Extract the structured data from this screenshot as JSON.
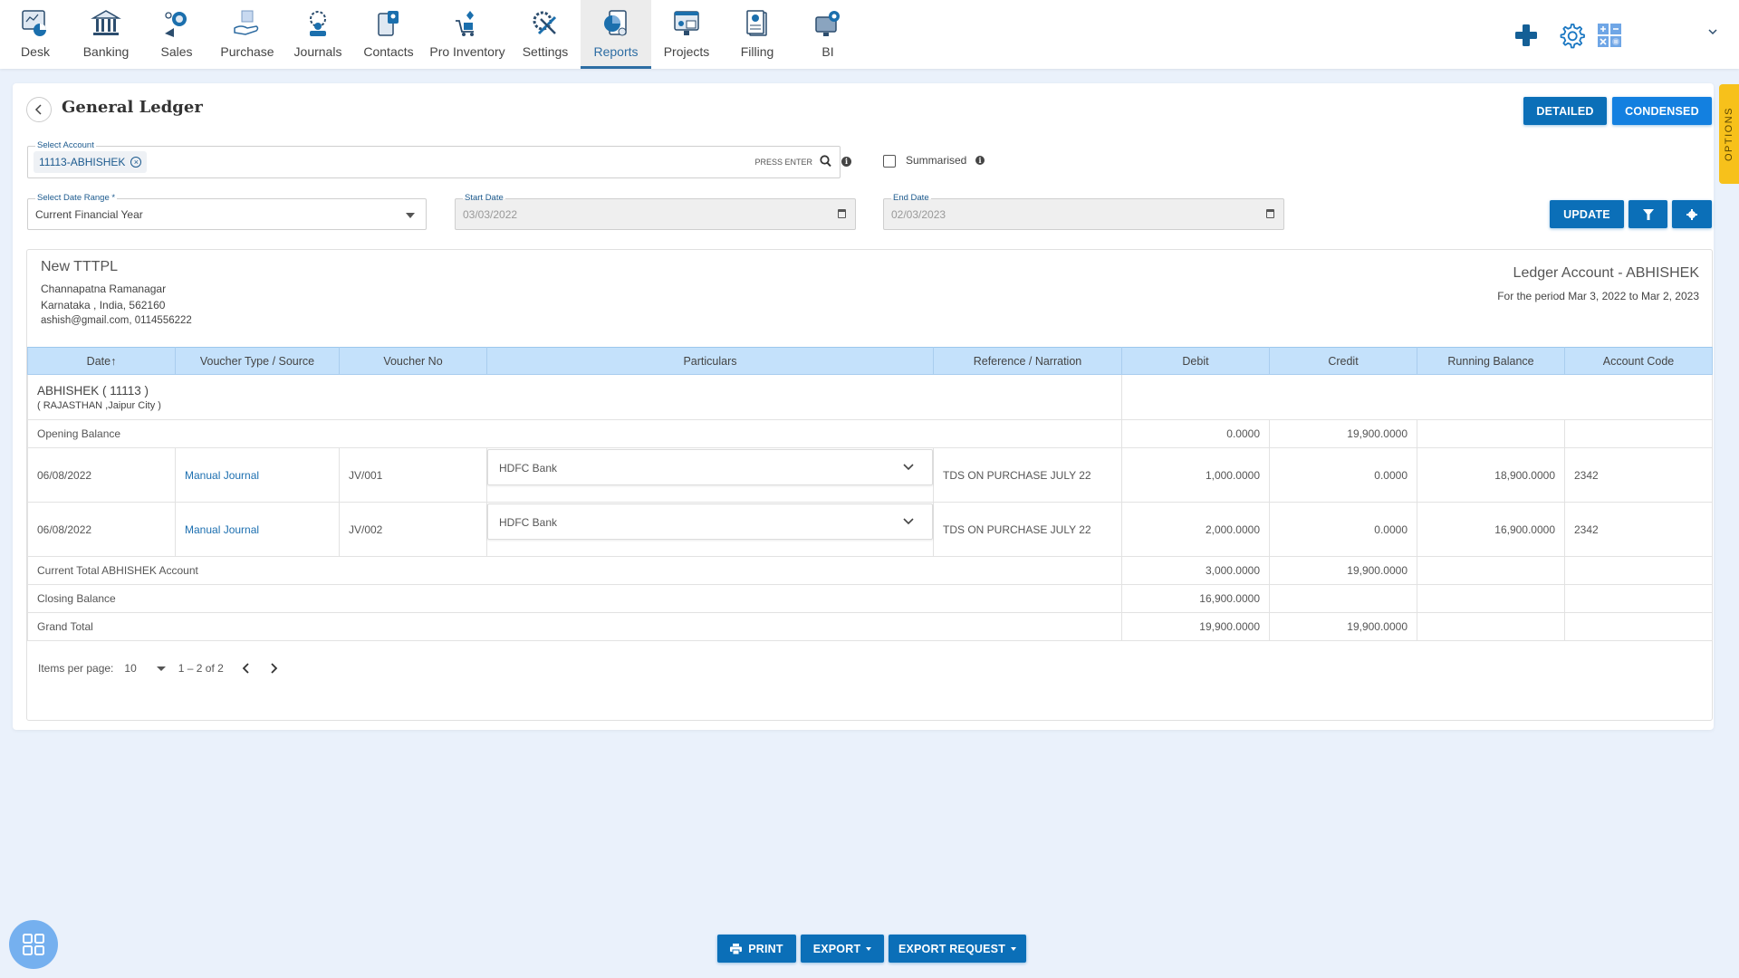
{
  "nav": {
    "items": [
      {
        "label": "Desk",
        "icon": "desk-icon"
      },
      {
        "label": "Banking",
        "icon": "bank-icon"
      },
      {
        "label": "Sales",
        "icon": "sales-icon"
      },
      {
        "label": "Purchase",
        "icon": "purchase-icon"
      },
      {
        "label": "Journals",
        "icon": "journals-icon"
      },
      {
        "label": "Contacts",
        "icon": "contacts-icon"
      },
      {
        "label": "Pro Inventory",
        "icon": "inventory-icon"
      },
      {
        "label": "Settings",
        "icon": "settings-icon"
      },
      {
        "label": "Reports",
        "icon": "reports-icon",
        "active": true
      },
      {
        "label": "Projects",
        "icon": "projects-icon"
      },
      {
        "label": "Filling",
        "icon": "filling-icon"
      },
      {
        "label": "BI",
        "icon": "bi-icon"
      }
    ],
    "right_icons": [
      "plus-icon",
      "gear-icon",
      "calculator-icon",
      "chevron-down-icon"
    ]
  },
  "page": {
    "title": "General Ledger",
    "view_buttons": {
      "detailed": "DETAILED",
      "condensed": "CONDENSED"
    },
    "options_tab": "OPTIONS"
  },
  "filters": {
    "account": {
      "label": "Select Account",
      "chip": "11113-ABHISHEK",
      "hint": "PRESS ENTER"
    },
    "summarised": {
      "label": "Summarised",
      "checked": false
    },
    "date_range": {
      "label": "Select Date Range *",
      "value": "Current Financial Year"
    },
    "start_date": {
      "label": "Start Date",
      "value": "03/03/2022"
    },
    "end_date": {
      "label": "End Date",
      "value": "02/03/2023"
    },
    "update_label": "UPDATE"
  },
  "report": {
    "company": "New TTTPL",
    "address_line1": "Channapatna Ramanagar",
    "address_line2": "Karnataka , India, 562160",
    "contact": "ashish@gmail.com, 0114556222",
    "ledger_title": "Ledger Account - ABHISHEK",
    "period": "For the period Mar 3, 2022 to Mar 2, 2023"
  },
  "table": {
    "columns": [
      "Date↑",
      "Voucher Type / Source",
      "Voucher No",
      "Particulars",
      "Reference / Narration",
      "Debit",
      "Credit",
      "Running Balance",
      "Account Code"
    ],
    "account_header": {
      "name": "ABHISHEK ( 11113 )",
      "location": "( RAJASTHAN ,Jaipur City )"
    },
    "opening": {
      "label": "Opening Balance",
      "debit": "0.0000",
      "credit": "19,900.0000"
    },
    "rows": [
      {
        "date": "06/08/2022",
        "voucher_type": "Manual Journal",
        "voucher_no": "JV/001",
        "particulars": "HDFC Bank",
        "narration": "TDS ON PURCHASE JULY 22",
        "debit": "1,000.0000",
        "credit": "0.0000",
        "running_balance": "18,900.0000",
        "account_code": "2342"
      },
      {
        "date": "06/08/2022",
        "voucher_type": "Manual Journal",
        "voucher_no": "JV/002",
        "particulars": "HDFC Bank",
        "narration": "TDS ON PURCHASE JULY 22",
        "debit": "2,000.0000",
        "credit": "0.0000",
        "running_balance": "16,900.0000",
        "account_code": "2342"
      }
    ],
    "current_total": {
      "label": "Current Total ABHISHEK Account",
      "debit": "3,000.0000",
      "credit": "19,900.0000"
    },
    "closing": {
      "label": "Closing Balance",
      "debit": "16,900.0000",
      "credit": ""
    },
    "grand_total": {
      "label": "Grand Total",
      "debit": "19,900.0000",
      "credit": "19,900.0000"
    }
  },
  "pager": {
    "label": "Items per page:",
    "per_page": "10",
    "range": "1 – 2 of 2"
  },
  "footer": {
    "print": "PRINT",
    "export": "EXPORT",
    "export_request": "EXPORT REQUEST"
  },
  "colors": {
    "primary": "#0b6fb8",
    "accent": "#1380e0",
    "header_row": "#c4e1fb",
    "options_tab": "#f7c11b"
  }
}
